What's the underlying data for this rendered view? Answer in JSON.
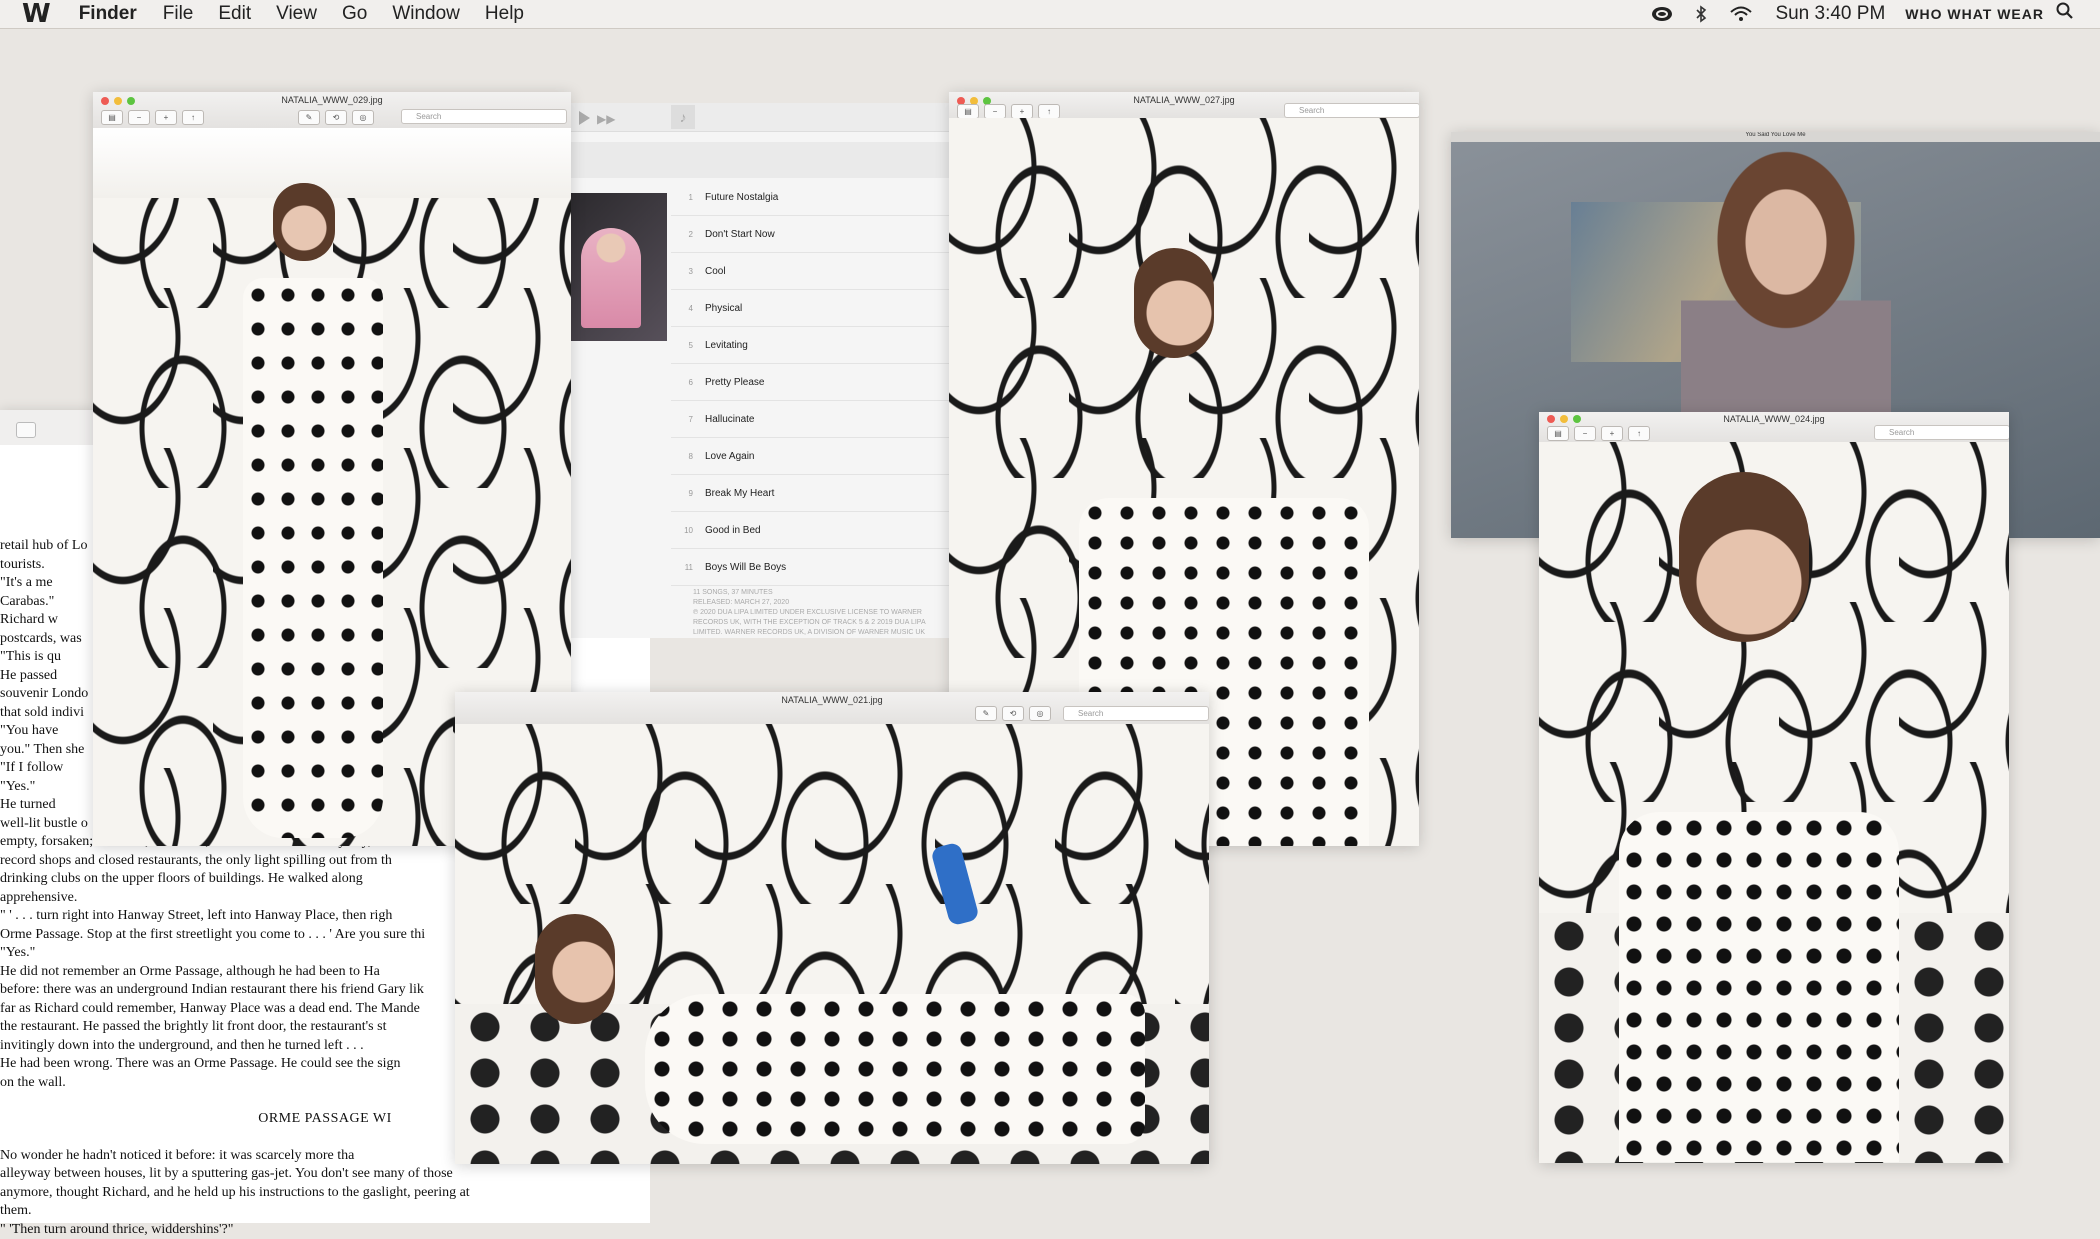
{
  "menubar": {
    "logo": "W",
    "app": "Finder",
    "items": [
      "File",
      "Edit",
      "View",
      "Go",
      "Window",
      "Help"
    ],
    "clock": "Sun 3:40 PM",
    "brand": "WHO WHAT WEAR"
  },
  "windows": {
    "w1": {
      "title": "NATALIA_WWW_029.jpg",
      "search": "Search"
    },
    "w2": {
      "title": "NATALIA_WWW_027.jpg",
      "search": "Search"
    },
    "w3": {
      "title": "NATALIA_WWW_021.jpg",
      "search": "Search"
    },
    "w4": {
      "title": "NATALIA_WWW_024.jpg",
      "search": "Search"
    },
    "video": {
      "title": "You Said You Love Me"
    }
  },
  "music": {
    "tracks": [
      {
        "n": "1",
        "name": "Future Nostalgia"
      },
      {
        "n": "2",
        "name": "Don't Start Now"
      },
      {
        "n": "3",
        "name": "Cool"
      },
      {
        "n": "4",
        "name": "Physical"
      },
      {
        "n": "5",
        "name": "Levitating"
      },
      {
        "n": "6",
        "name": "Pretty Please"
      },
      {
        "n": "7",
        "name": "Hallucinate"
      },
      {
        "n": "8",
        "name": "Love Again"
      },
      {
        "n": "9",
        "name": "Break My Heart"
      },
      {
        "n": "10",
        "name": "Good in Bed"
      },
      {
        "n": "11",
        "name": "Boys Will Be Boys"
      }
    ],
    "summary": "11 SONGS, 37 MINUTES",
    "released": "RELEASED: MARCH 27, 2020",
    "copyright": "℗ 2020 DUA LIPA LIMITED UNDER EXCLUSIVE LICENSE TO WARNER RECORDS UK, WITH THE EXCEPTION OF TRACK 5 & 2 2019 DUA LIPA LIMITED. WARNER RECORDS UK, A DIVISION OF WARNER MUSIC UK LIMITED"
  },
  "book": {
    "lines": [
      "retail hub of Lo",
      "tourists.",
      "  \"It's a me",
      "Carabas.\"",
      "  Richard w",
      "postcards, was",
      "\"This is qu",
      "  He passed",
      "souvenir Londo",
      "that sold indivi",
      "  \"You have",
      "you.\" Then she",
      "  \"If I follow",
      "  \"Yes.\"",
      "  He turned",
      "well-lit bustle o",
      "empty, forsaken; a narrow, dark road, little more than an alleyway, filled w",
      "record shops and closed restaurants, the only light spilling out from th",
      "drinking clubs on the upper floors of buildings. He walked along",
      "apprehensive.",
      "  \" ' . . . turn right into Hanway Street, left into Hanway Place, then righ",
      "Orme Passage. Stop at the first streetlight you come to . . . ' Are you sure thi",
      "  \"Yes.\"",
      "  He did not remember an Orme Passage, although he had been to Ha",
      "before: there was an underground Indian restaurant there his friend Gary lik",
      "far as Richard could remember, Hanway Place was a dead end. The Mande",
      "the restaurant. He passed the brightly lit front door, the restaurant's st",
      "invitingly down into the underground, and then he turned left . . .",
      "  He had been wrong. There was an Orme Passage. He could see the sign",
      "on the wall."
    ],
    "heading": "ORME PASSAGE WI",
    "lines2": [
      "  No wonder he hadn't noticed it before: it was scarcely more tha",
      "alleyway between houses, lit by a sputtering gas-jet. You don't see many of those",
      "anymore, thought Richard, and he held up his instructions to the gaslight, peering at",
      "them.",
      "  \" 'Then turn around thrice, widdershins'?\""
    ]
  }
}
